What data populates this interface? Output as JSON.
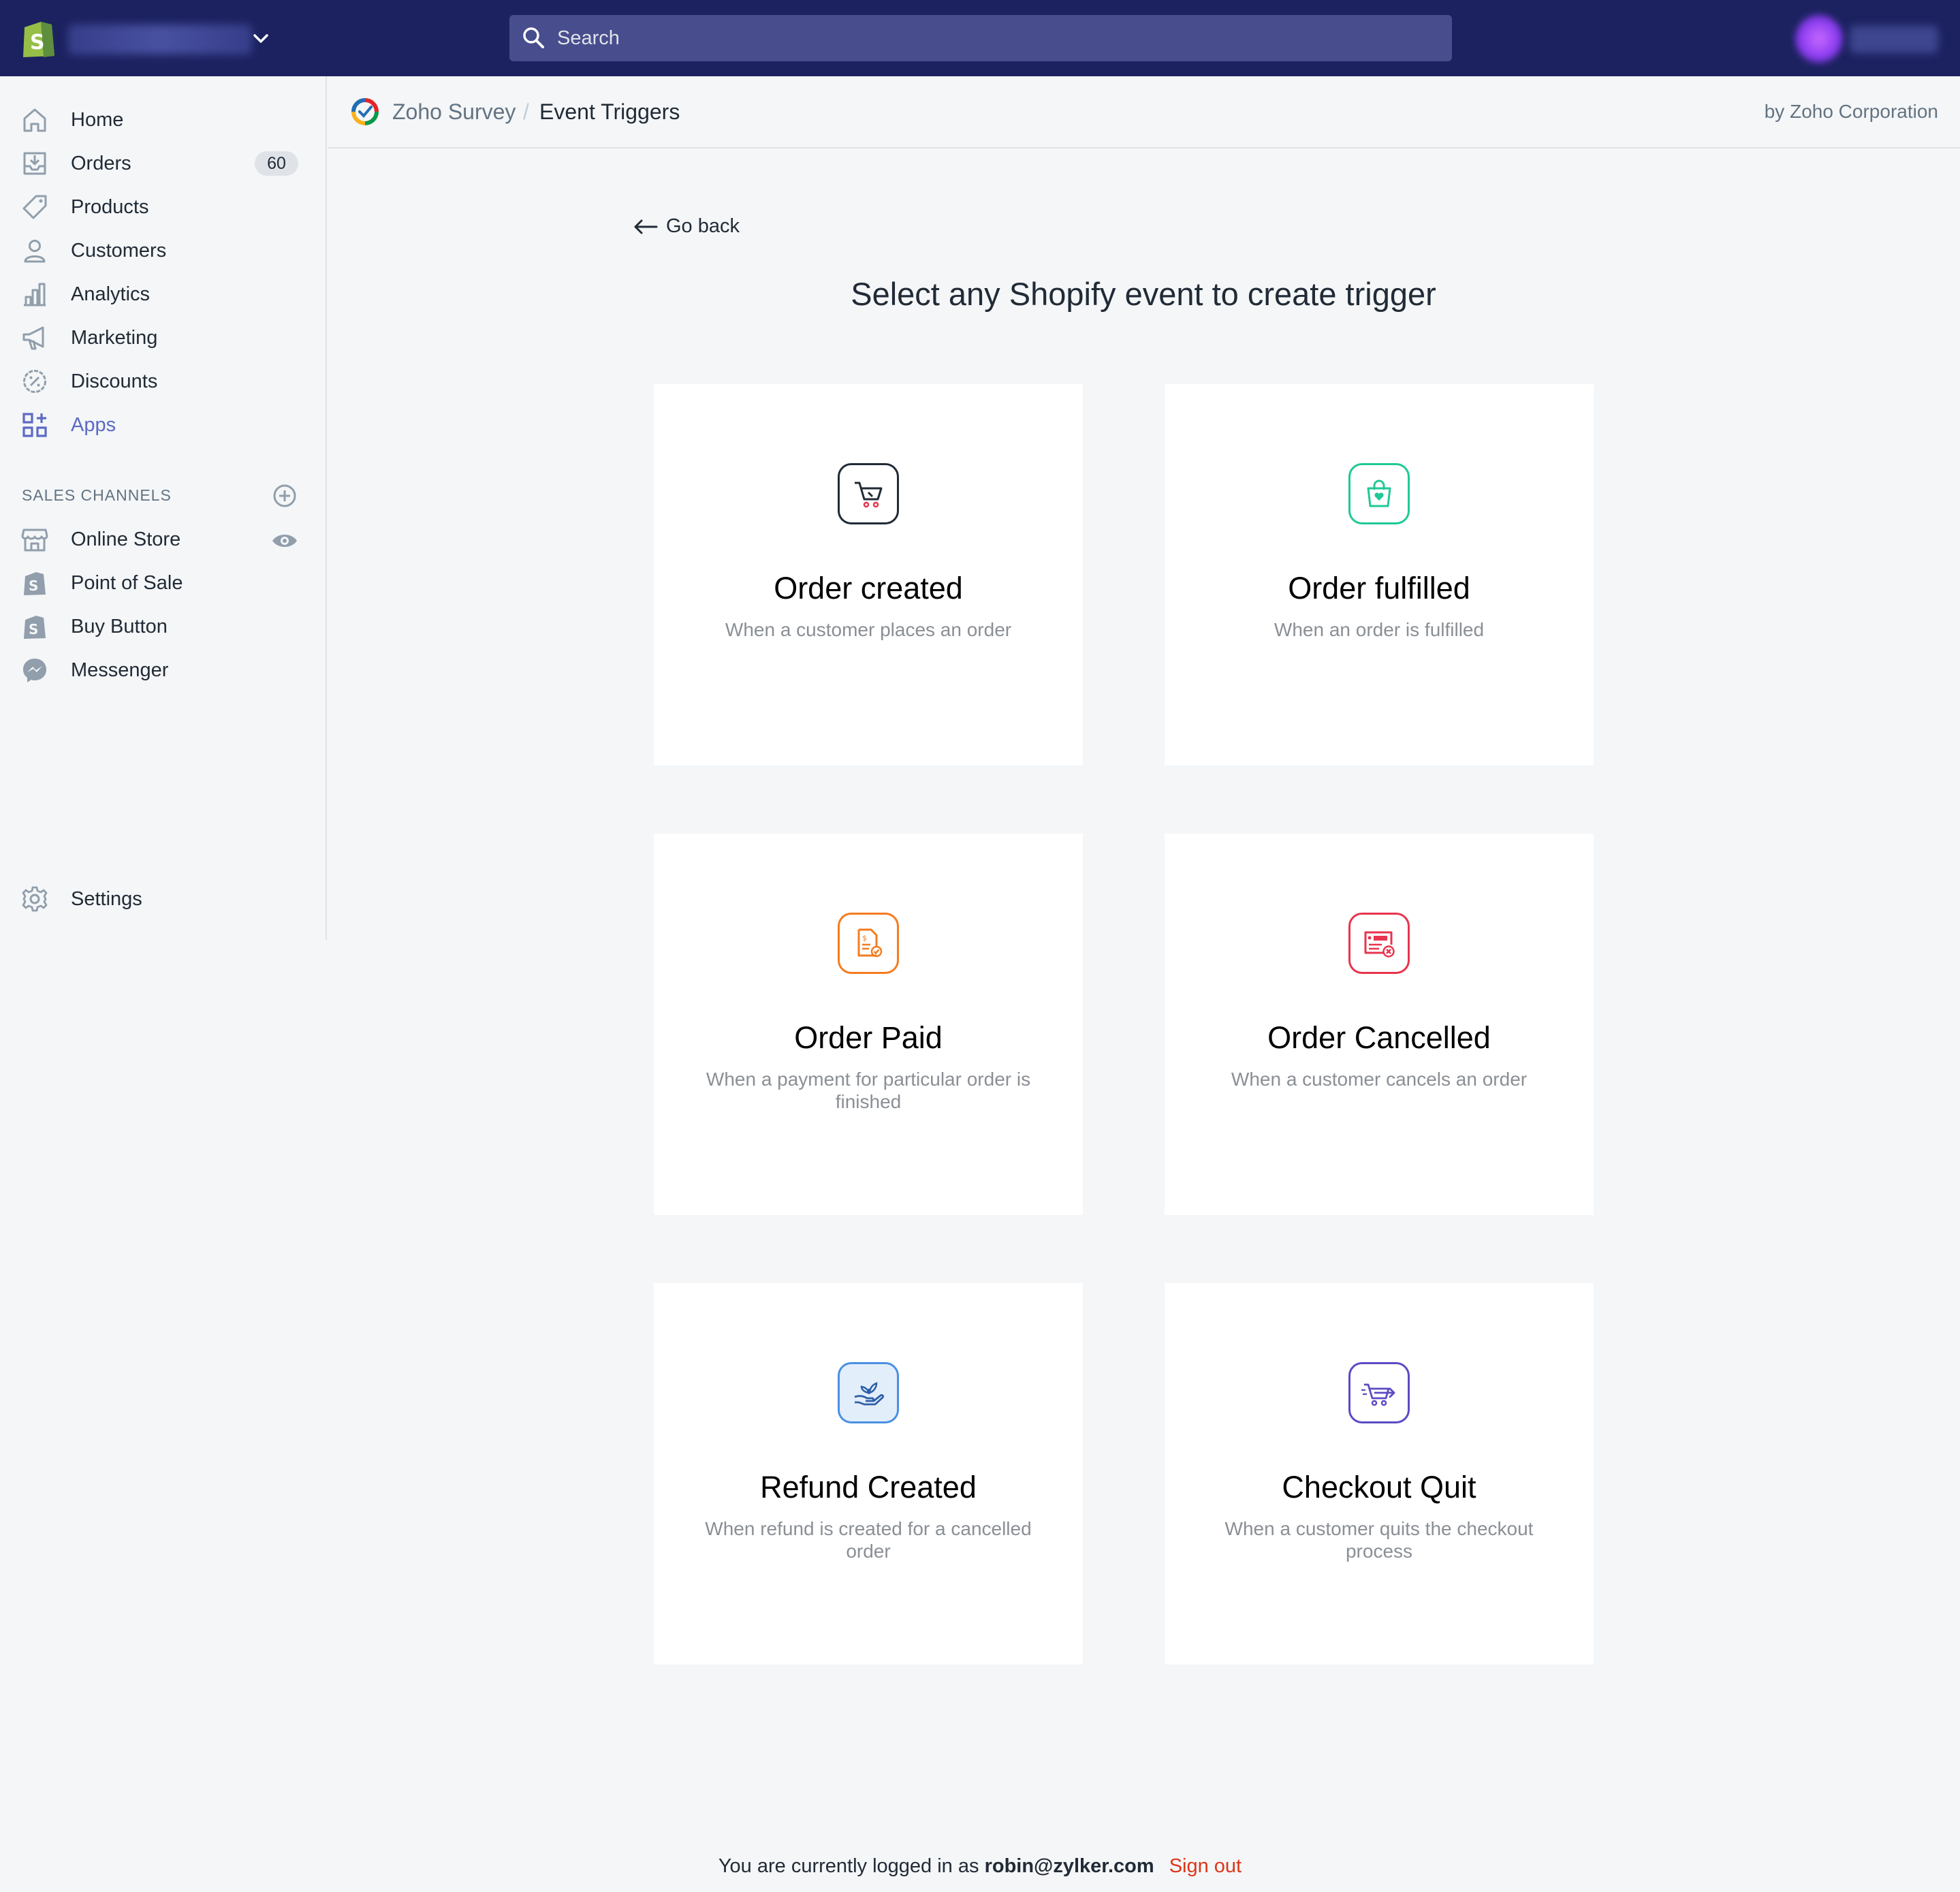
{
  "topbar": {
    "search_placeholder": "Search"
  },
  "sidebar": {
    "items": [
      {
        "label": "Home"
      },
      {
        "label": "Orders",
        "badge": "60"
      },
      {
        "label": "Products"
      },
      {
        "label": "Customers"
      },
      {
        "label": "Analytics"
      },
      {
        "label": "Marketing"
      },
      {
        "label": "Discounts"
      },
      {
        "label": "Apps"
      }
    ],
    "sales_channels_title": "SALES CHANNELS",
    "channels": [
      {
        "label": "Online Store"
      },
      {
        "label": "Point of Sale"
      },
      {
        "label": "Buy Button"
      },
      {
        "label": "Messenger"
      }
    ],
    "settings_label": "Settings"
  },
  "titlebar": {
    "app_name": "Zoho Survey",
    "separator": "/",
    "page_name": "Event Triggers",
    "byline": "by Zoho Corporation"
  },
  "main": {
    "go_back": "Go back",
    "heading": "Select any Shopify event to create trigger",
    "cards": [
      {
        "title": "Order created",
        "desc": "When a customer places an order",
        "icon": "cart-icon",
        "color": "#212b36"
      },
      {
        "title": "Order fulfilled",
        "desc": "When an order is fulfilled",
        "icon": "shopping-bag-icon",
        "color": "#20c997"
      },
      {
        "title": "Order Paid",
        "desc": "When a payment for particular order is finished",
        "icon": "paid-invoice-icon",
        "color": "#f47c20"
      },
      {
        "title": "Order Cancelled",
        "desc": "When a customer cancels an order",
        "icon": "cancelled-order-icon",
        "color": "#e8344e"
      },
      {
        "title": "Refund Created",
        "desc": "When refund is created for a cancelled order",
        "icon": "refund-hand-icon",
        "color": "#4a90e2"
      },
      {
        "title": "Checkout Quit",
        "desc": "When a customer quits the checkout process",
        "icon": "checkout-cart-icon",
        "color": "#5b4bc4"
      }
    ]
  },
  "footer": {
    "prefix": "You are currently logged in as",
    "email": "robin@zylker.com",
    "sign_out": "Sign out"
  }
}
